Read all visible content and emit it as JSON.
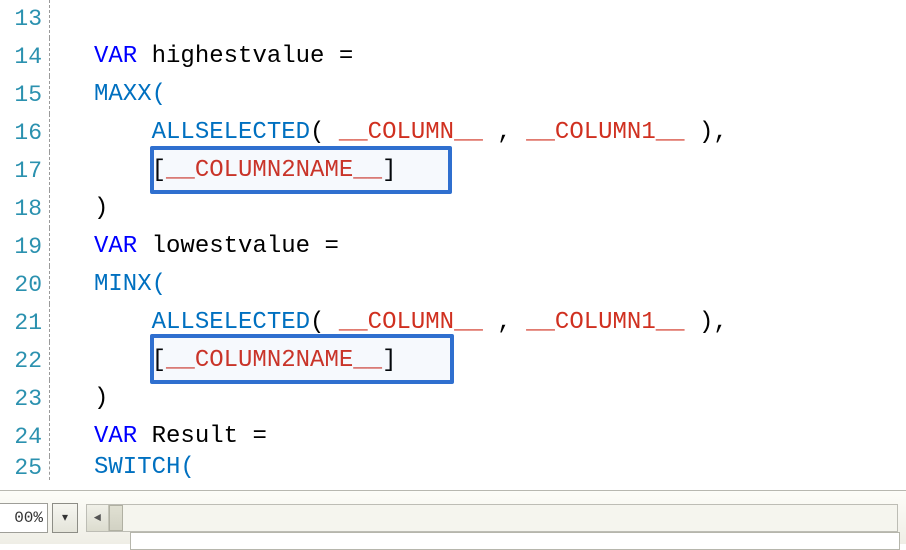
{
  "code": {
    "first_line_number": 13,
    "indent1": "    ",
    "indent2": "        ",
    "var_kw": "VAR",
    "highestvalue_decl": " highestvalue =",
    "maxx_open": "MAXX(",
    "minx_open": "MINX(",
    "allselected_name": "ALLSELECTED",
    "open_space": "( ",
    "tmpl_col": "__COLUMN__",
    "comma_sep": " , ",
    "tmpl_col1": "__COLUMN1__",
    "close_trail": " ),",
    "bracket_open": "[",
    "tmpl_col2name": "__COLUMN2NAME__",
    "bracket_close": "]",
    "close_paren": ")",
    "lowestvalue_decl": " lowestvalue =",
    "result_decl": " Result =",
    "switch_open": "SWITCH("
  },
  "statusbar": {
    "zoom_value": "00%"
  },
  "icons": {
    "dropdown_arrow": "▾",
    "scroll_left_arrow": "◄"
  },
  "line_numbers": [
    "13",
    "14",
    "15",
    "16",
    "17",
    "18",
    "19",
    "20",
    "21",
    "22",
    "23",
    "24",
    "25"
  ]
}
